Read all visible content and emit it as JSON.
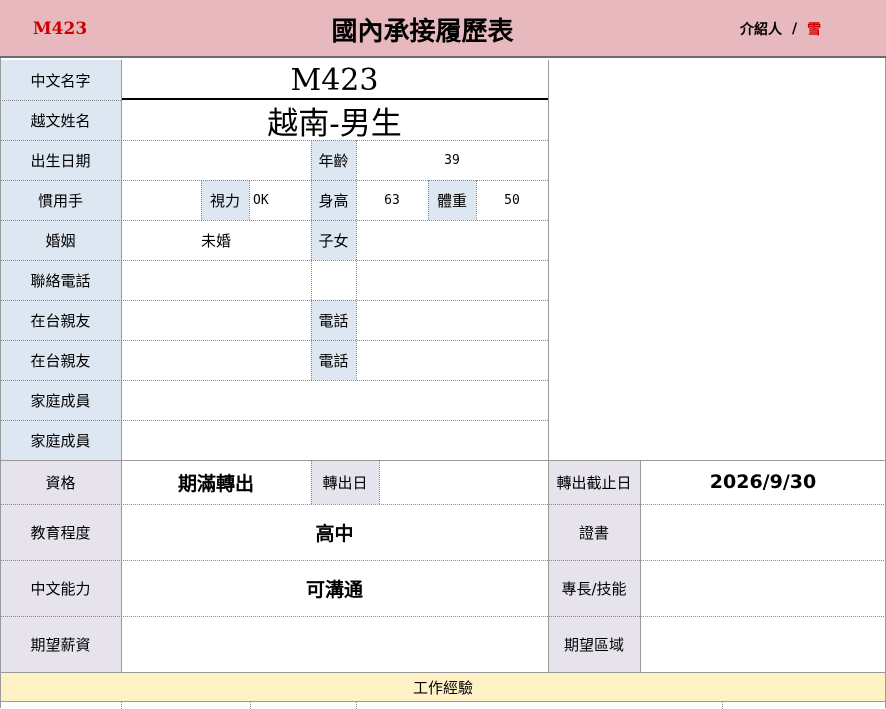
{
  "header": {
    "code": "M423",
    "title": "國內承接履歷表",
    "referrer_label": "介紹人",
    "separator": "/",
    "referrer_name": "雪"
  },
  "labels": {
    "chinese_name": "中文名字",
    "viet_name": "越文姓名",
    "birth_date": "出生日期",
    "age": "年齡",
    "handedness": "慣用手",
    "eyesight": "視力",
    "height": "身高",
    "weight": "體重",
    "marital": "婚姻",
    "children": "子女",
    "contact_phone": "聯絡電話",
    "relative_1": "在台親友",
    "phone_1": "電話",
    "relative_2": "在台親友",
    "phone_2": "電話",
    "family_1": "家庭成員",
    "family_2": "家庭成員",
    "qualification": "資格",
    "transfer_date": "轉出日",
    "transfer_deadline": "轉出截止日",
    "education": "教育程度",
    "certificate": "證書",
    "chinese_ability": "中文能力",
    "specialty": "專長/技能",
    "expected_salary": "期望薪資",
    "expected_area": "期望區域"
  },
  "values": {
    "chinese_name": "M423",
    "viet_name": "越南-男生",
    "birth_date": "",
    "age": "39",
    "handedness": "",
    "eyesight": "OK",
    "height": "63",
    "weight": "50",
    "marital": "未婚",
    "children": "",
    "contact_phone": "",
    "relative_1": "",
    "phone_1": "",
    "relative_2": "",
    "phone_2": "",
    "family_1": "",
    "family_2": "",
    "qualification": "期滿轉出",
    "transfer_date": "",
    "transfer_deadline": "2026/9/30",
    "education": "高中",
    "certificate": "",
    "chinese_ability": "可溝通",
    "specialty": "",
    "expected_salary": "",
    "expected_area": ""
  },
  "footer": {
    "section_title": "工作經驗"
  },
  "colors": {
    "header_bg": "#e7b8bd",
    "label_bg": "#dde7f2",
    "label_bg_lower": "#e7e3ec",
    "footer_bg": "#fff1c6",
    "accent_red": "#cc0000"
  }
}
